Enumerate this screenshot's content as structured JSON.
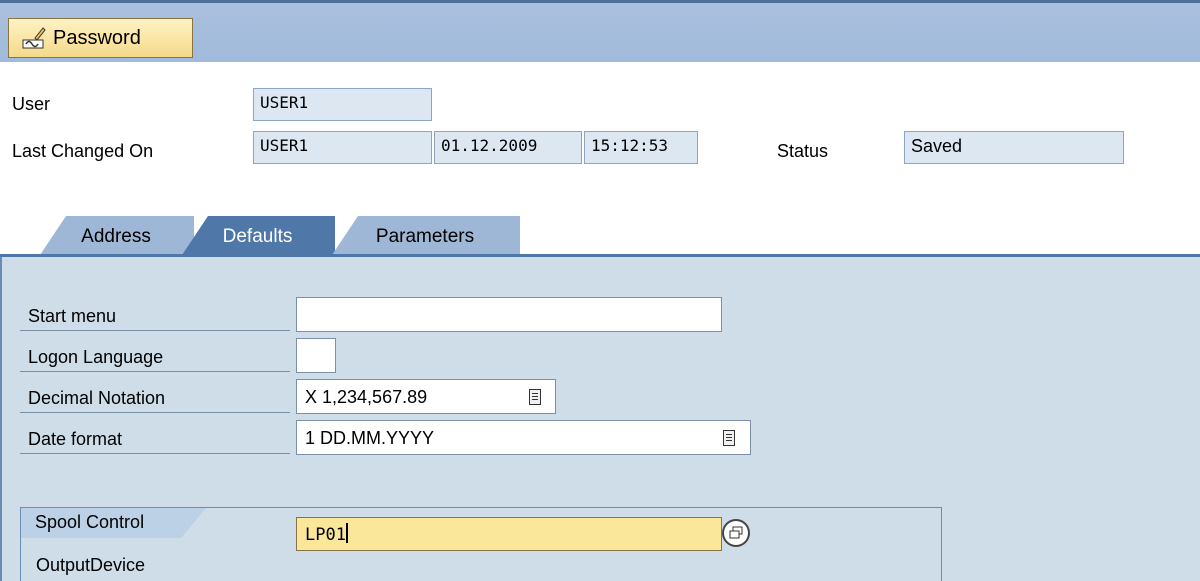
{
  "toolbar": {
    "password_label": "Password"
  },
  "header": {
    "user_label": "User",
    "user_value": "USER1",
    "last_changed_label": "Last Changed On",
    "last_changed_user": "USER1",
    "last_changed_date": "01.12.2009",
    "last_changed_time": "15:12:53",
    "status_label": "Status",
    "status_value": "Saved"
  },
  "tabs": [
    {
      "label": "Address",
      "active": false
    },
    {
      "label": "Defaults",
      "active": true
    },
    {
      "label": "Parameters",
      "active": false
    }
  ],
  "defaults": {
    "start_menu_label": "Start menu",
    "start_menu_value": "",
    "logon_language_label": "Logon Language",
    "logon_language_value": "",
    "decimal_notation_label": "Decimal Notation",
    "decimal_notation_value": "X 1,234,567.89",
    "date_format_label": "Date format",
    "date_format_value": "1 DD.MM.YYYY"
  },
  "spool": {
    "title": "Spool Control",
    "output_device_label": "OutputDevice",
    "output_device_value": "LP01"
  },
  "colors": {
    "toolbar_bg": "#a9c0de",
    "panel_bg": "#cfdde9",
    "active_tab": "#4f78a8",
    "highlight_field": "#fbe79a"
  },
  "icons": {
    "password": "pencil-key-icon",
    "dropdown": "list-icon",
    "search_help": "search-help-icon"
  }
}
